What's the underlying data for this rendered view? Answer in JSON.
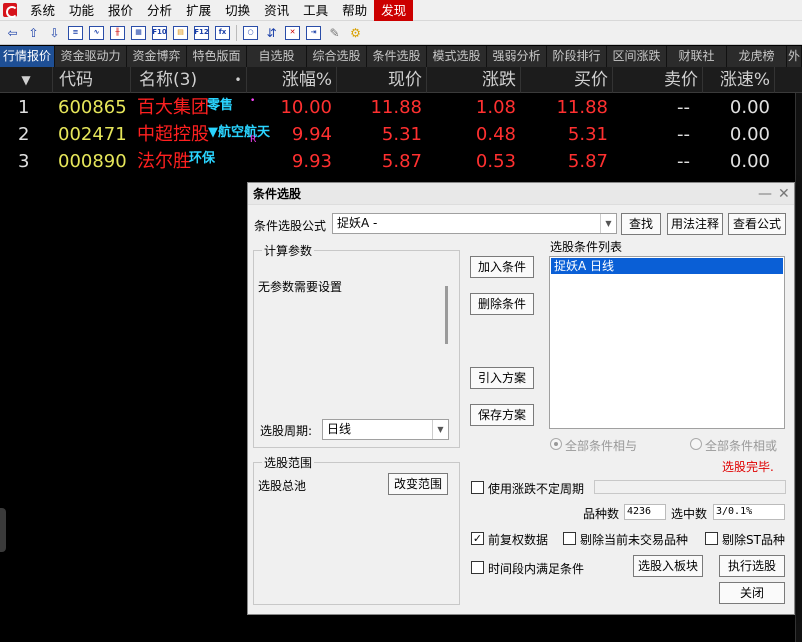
{
  "menu": [
    "系统",
    "功能",
    "报价",
    "分析",
    "扩展",
    "切换",
    "资讯",
    "工具",
    "帮助",
    "发现"
  ],
  "toolbar": {
    "icons": [
      "arrow-left-icon",
      "arrow-up-icon",
      "arrow-down-icon",
      "report-icon",
      "line-chart-icon",
      "candlestick-icon",
      "grid-icon",
      "f10-icon",
      "info-icon",
      "f12-icon",
      "fx-icon",
      "circle-icon",
      "indicator-icon",
      "cross-icon",
      "function-icon",
      "brush-icon",
      "gear-icon"
    ],
    "f10": "F10",
    "f12": "F12",
    "fx": "fx"
  },
  "tabs": [
    "行情报价",
    "资金驱动力",
    "资金博弈",
    "特色版面",
    "自选股",
    "综合选股",
    "条件选股",
    "模式选股",
    "强弱分析",
    "阶段排行",
    "区间涨跌",
    "财联社",
    "龙虎榜",
    "外"
  ],
  "columns": {
    "sort": "▼",
    "code": "代码",
    "name": "名称(3)",
    "dot": "•",
    "pct": "涨幅%",
    "price": "现价",
    "change": "涨跌",
    "bid": "买价",
    "ask": "卖价",
    "speed": "涨速%"
  },
  "rows": [
    {
      "idx": "1",
      "code": "600865",
      "name": "百大集团",
      "tag": "零售",
      "flag": "",
      "pct": "10.00",
      "price": "11.88",
      "change": "1.08",
      "bid": "11.88",
      "ask": "--",
      "speed": "0.00"
    },
    {
      "idx": "2",
      "code": "002471",
      "name": "中超控股",
      "tag": "▼航空航天",
      "flag": "R",
      "pct": "9.94",
      "price": "5.31",
      "change": "0.48",
      "bid": "5.31",
      "ask": "--",
      "speed": "0.00"
    },
    {
      "idx": "3",
      "code": "000890",
      "name": "法尔胜",
      "tag": "环保",
      "flag": "",
      "pct": "9.93",
      "price": "5.87",
      "change": "0.53",
      "bid": "5.87",
      "ask": "--",
      "speed": "0.00"
    }
  ],
  "dialog": {
    "title": "条件选股",
    "minimize": "—",
    "close": "✕",
    "formula_label": "条件选股公式",
    "formula_value": "捉妖A  -",
    "find": "查找",
    "usage": "用法注释",
    "view_formula": "查看公式",
    "params_group": "计算参数",
    "params_text": "无参数需要设置",
    "period_label": "选股周期:",
    "period_value": "日线",
    "scope_group": "选股范围",
    "scope_value": "选股总池",
    "change_scope": "改变范围",
    "add_condition": "加入条件",
    "delete_condition": "删除条件",
    "import_plan": "引入方案",
    "save_plan": "保存方案",
    "list_label": "选股条件列表",
    "list_item": "捉妖A  日线",
    "all_and": "全部条件相与",
    "all_or": "全部条件相或",
    "status": "选股完毕.",
    "use_uncertain": "使用涨跌不定周期",
    "count_label": "品种数",
    "count_value": "4236",
    "selected_label": "选中数",
    "selected_value": "3/0.1%",
    "pre_adjust": "前复权数据",
    "exclude_untraded": "剔除当前未交易品种",
    "exclude_st": "剔除ST品种",
    "period_satisfy": "时间段内满足条件",
    "to_block": "选股入板块",
    "execute": "执行选股",
    "close_btn": "关闭",
    "check_mark": "✓"
  },
  "colors": {
    "code": "#e6e65a",
    "name": "#ff2020",
    "up": "#ff3030",
    "flat": "#e0e0e0",
    "tag": "#2ad4ff",
    "active_tab": "#1e4f95",
    "status": "#e00000"
  }
}
